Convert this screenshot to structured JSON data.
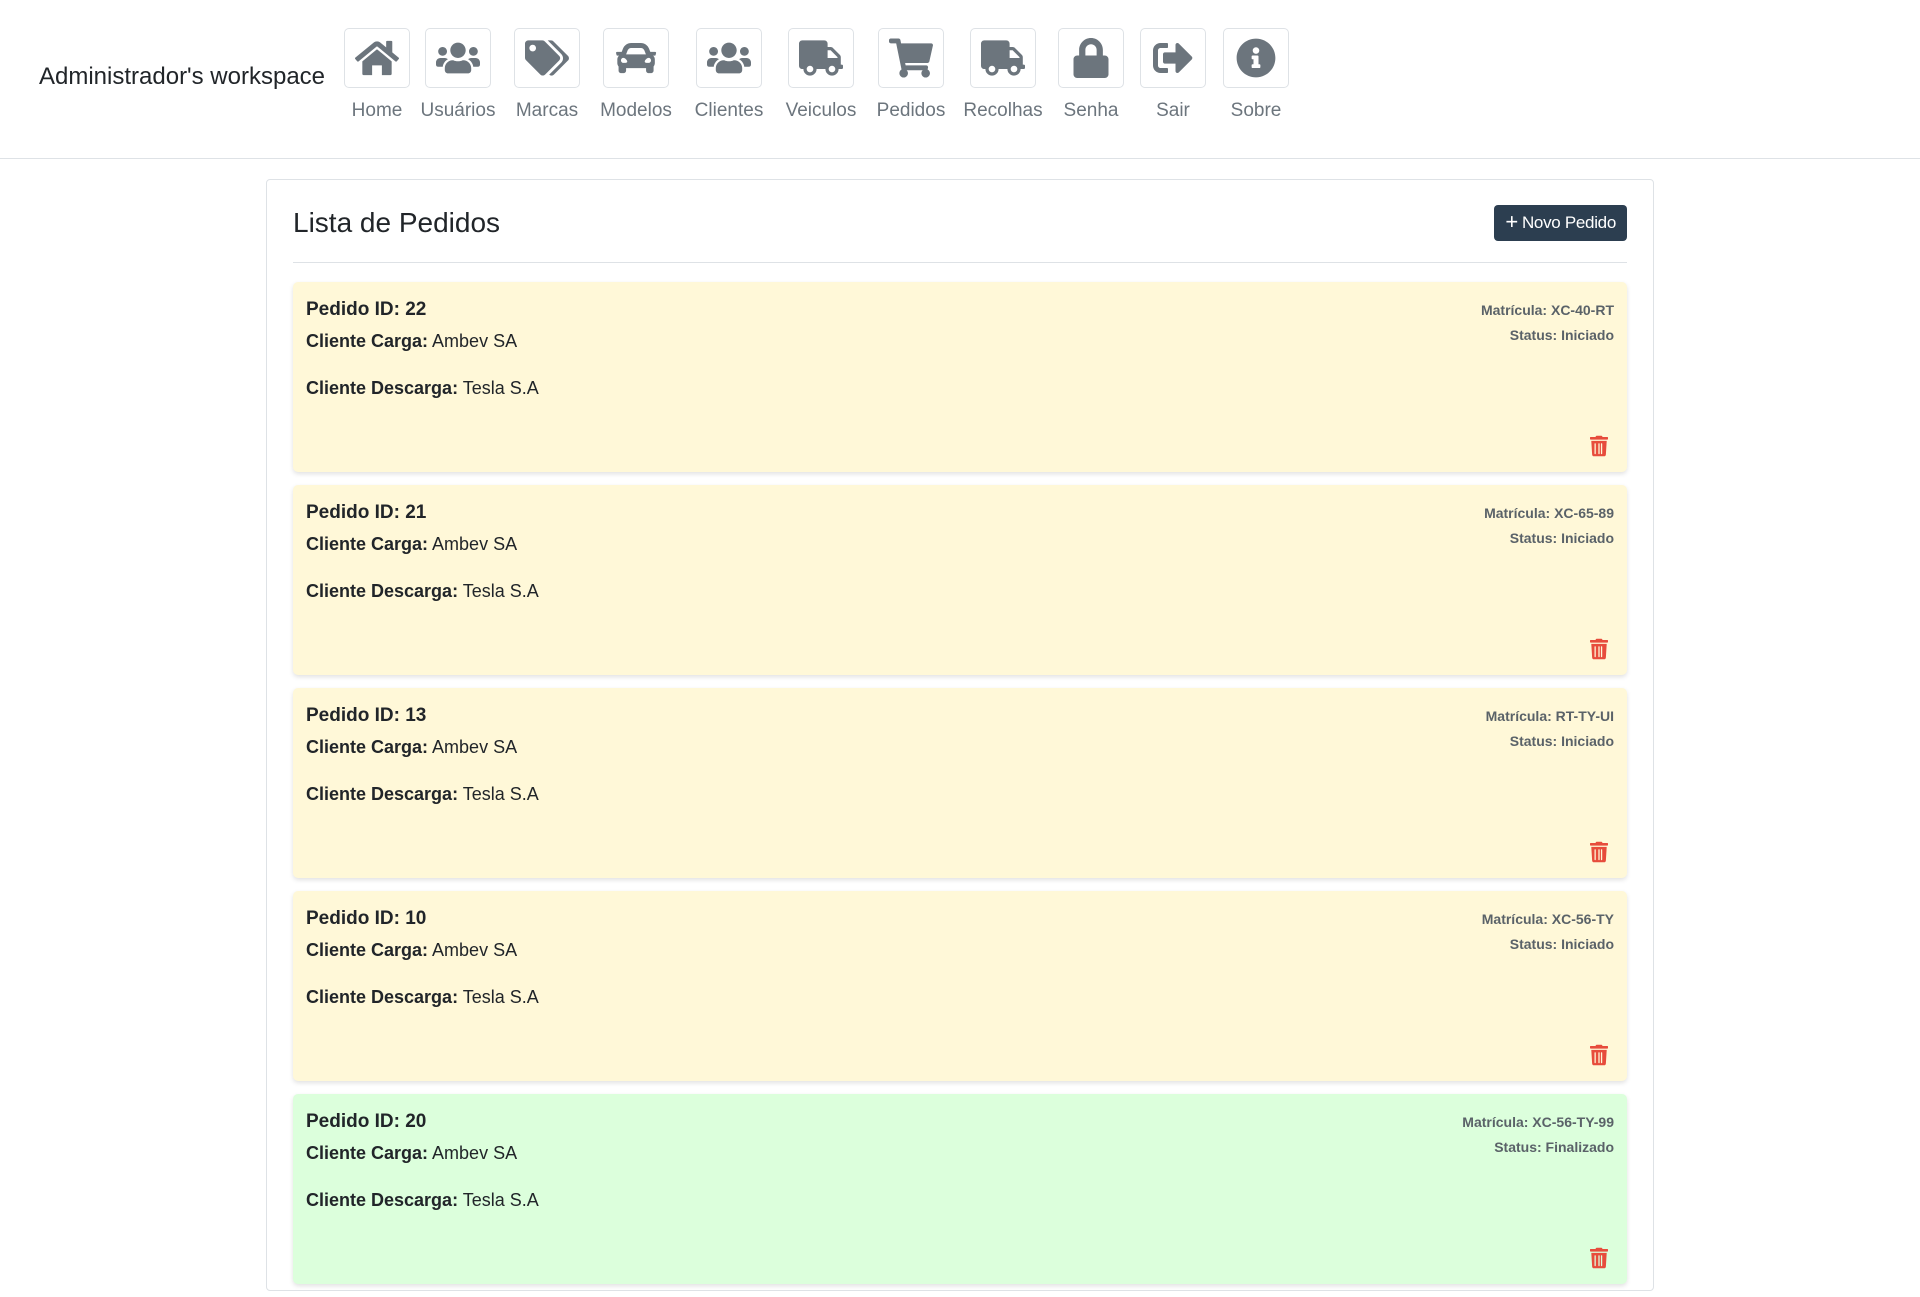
{
  "header": {
    "brand": "Administrador's workspace",
    "nav": [
      {
        "label": "Home",
        "icon": "home-icon"
      },
      {
        "label": "Usuários",
        "icon": "users-icon"
      },
      {
        "label": "Marcas",
        "icon": "tags-icon"
      },
      {
        "label": "Modelos",
        "icon": "car-icon"
      },
      {
        "label": "Clientes",
        "icon": "users-icon"
      },
      {
        "label": "Veiculos",
        "icon": "truck-icon"
      },
      {
        "label": "Pedidos",
        "icon": "cart-icon"
      },
      {
        "label": "Recolhas",
        "icon": "truck-icon"
      },
      {
        "label": "Senha",
        "icon": "lock-icon"
      },
      {
        "label": "Sair",
        "icon": "sign-out-icon"
      },
      {
        "label": "Sobre",
        "icon": "info-icon"
      }
    ]
  },
  "main": {
    "title": "Lista de Pedidos",
    "new_button_label": "Novo Pedido",
    "labels": {
      "pedido_id": "Pedido ID:",
      "cliente_carga": "Cliente Carga:",
      "cliente_descarga": "Cliente Descarga:",
      "matricula": "Matrícula:",
      "status": "Status:"
    },
    "orders": [
      {
        "id": "22",
        "cliente_carga": "Ambev SA",
        "cliente_descarga": "Tesla S.A",
        "matricula": "XC-40-RT",
        "status": "Iniciado"
      },
      {
        "id": "21",
        "cliente_carga": "Ambev SA",
        "cliente_descarga": "Tesla S.A",
        "matricula": "XC-65-89",
        "status": "Iniciado"
      },
      {
        "id": "13",
        "cliente_carga": "Ambev SA",
        "cliente_descarga": "Tesla S.A",
        "matricula": "RT-TY-UI",
        "status": "Iniciado"
      },
      {
        "id": "10",
        "cliente_carga": "Ambev SA",
        "cliente_descarga": "Tesla S.A",
        "matricula": "XC-56-TY",
        "status": "Iniciado"
      },
      {
        "id": "20",
        "cliente_carga": "Ambev SA",
        "cliente_descarga": "Tesla S.A",
        "matricula": "XC-56-TY-99",
        "status": "Finalizado"
      }
    ]
  },
  "colors": {
    "iniciado_bg": "#fff8d8",
    "finalizado_bg": "#dcffdc",
    "button_bg": "#2c3e50",
    "trash": "#e74c3c",
    "nav_icon": "#6c757d"
  }
}
